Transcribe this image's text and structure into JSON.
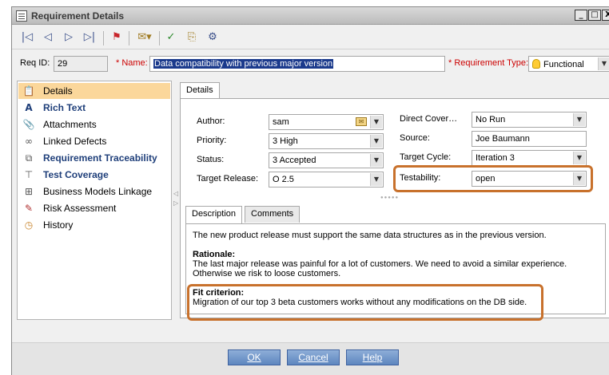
{
  "window": {
    "title": "Requirement Details",
    "controls": [
      "_",
      "□",
      "X"
    ]
  },
  "toolbar": {
    "buttons": [
      {
        "name": "first-record-icon",
        "glyph": "|◁"
      },
      {
        "name": "previous-record-icon",
        "glyph": "◁"
      },
      {
        "name": "next-record-icon",
        "glyph": "▷"
      },
      {
        "name": "last-record-icon",
        "glyph": "▷|"
      },
      {
        "name": "flag-icon",
        "glyph": "⚑"
      },
      {
        "name": "email-icon",
        "glyph": "✉▾"
      },
      {
        "name": "spelling-icon",
        "glyph": "✓"
      },
      {
        "name": "thesaurus-icon",
        "glyph": "⎘"
      },
      {
        "name": "spelling-options-icon",
        "glyph": "⚙"
      }
    ]
  },
  "req": {
    "id_label": "Req ID:",
    "id_value": "29",
    "name_label": "* Name:",
    "name_value": "Data compatibility with previous major version",
    "type_label": "* Requirement Type:",
    "type_value": "Functional"
  },
  "nav": [
    {
      "label": "Details",
      "icon": "📋",
      "selected": true
    },
    {
      "label": "Rich Text",
      "icon": "A",
      "bold": true
    },
    {
      "label": "Attachments",
      "icon": "📎"
    },
    {
      "label": "Linked Defects",
      "icon": "∞"
    },
    {
      "label": "Requirement Traceability",
      "icon": "⧉",
      "bold": true
    },
    {
      "label": "Test Coverage",
      "icon": "⊤",
      "bold": true
    },
    {
      "label": "Business Models Linkage",
      "icon": "⊞"
    },
    {
      "label": "Risk Assessment",
      "icon": "✎"
    },
    {
      "label": "History",
      "icon": "◷"
    }
  ],
  "details": {
    "tab": "Details",
    "author_label": "Author:",
    "author_value": "sam",
    "priority_label": "Priority:",
    "priority_value": "3 High",
    "status_label": "Status:",
    "status_value": "3 Accepted",
    "release_label": "Target Release:",
    "release_value": "O 2.5",
    "coverage_label": "Direct Cover…",
    "coverage_value": "No Run",
    "source_label": "Source:",
    "source_value": "Joe Baumann",
    "cycle_label": "Target Cycle:",
    "cycle_value": "Iteration 3",
    "testability_label": "Testability:",
    "testability_value": "open"
  },
  "desc": {
    "tabs": [
      "Description",
      "Comments"
    ],
    "line1": "The new product release must support the same data structures as in the previous version.",
    "rationale_head": "Rationale:",
    "rationale1": "The last major release was painful for a lot of customers. We need to avoid a similar experience.",
    "rationale2": "Otherwise we risk to loose customers.",
    "fit_head": "Fit criterion:",
    "fit1": "Migration of our top 3 beta customers works without any modifications on the DB side."
  },
  "buttons": {
    "ok": "OK",
    "cancel": "Cancel",
    "help": "Help"
  },
  "colors": {
    "highlight": "#c8712c",
    "nav_selected": "#fbd79b",
    "button": "#6f95cb"
  }
}
